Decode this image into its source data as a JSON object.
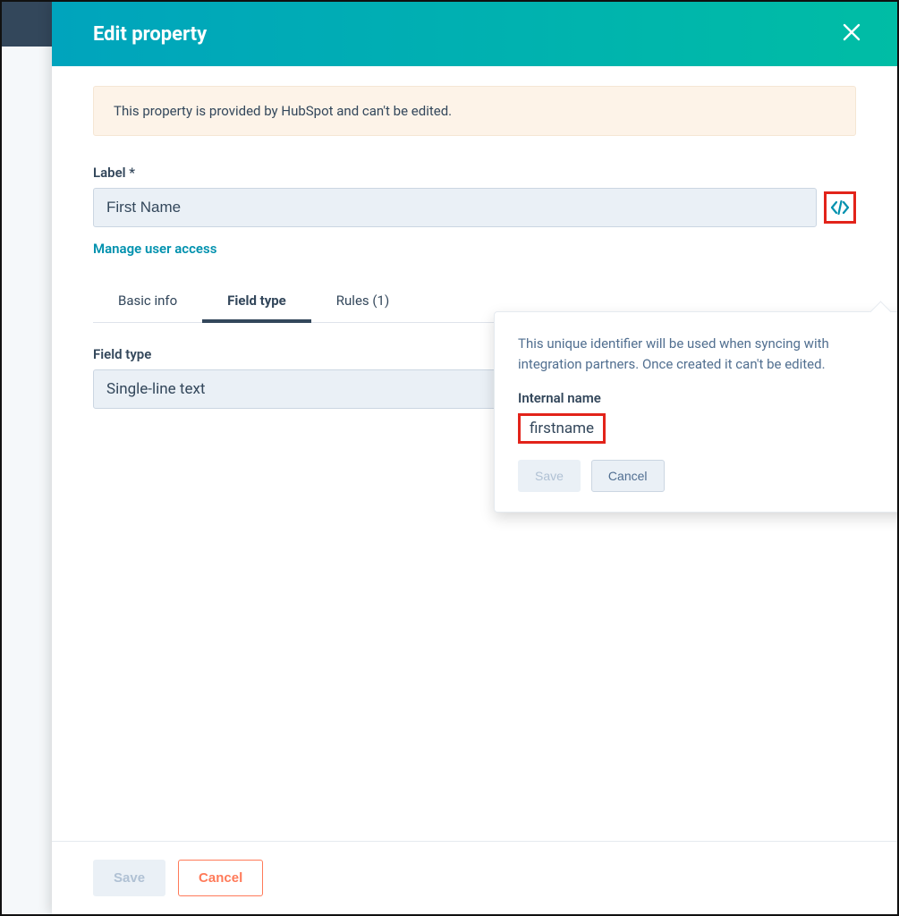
{
  "header": {
    "title": "Edit property"
  },
  "alert": {
    "text": "This property is provided by HubSpot and can't be edited."
  },
  "label_field": {
    "label": "Label *",
    "value": "First Name"
  },
  "manage_access_link": "Manage user access",
  "tabs": [
    {
      "label": "Basic info"
    },
    {
      "label": "Field type"
    },
    {
      "label": "Rules (1)"
    }
  ],
  "field_type": {
    "label": "Field type",
    "value": "Single-line text"
  },
  "popover": {
    "description": "This unique identifier will be used when syncing with integration partners. Once created it can't be edited.",
    "label": "Internal name",
    "value": "firstname",
    "save": "Save",
    "cancel": "Cancel"
  },
  "footer": {
    "save": "Save",
    "cancel": "Cancel"
  }
}
